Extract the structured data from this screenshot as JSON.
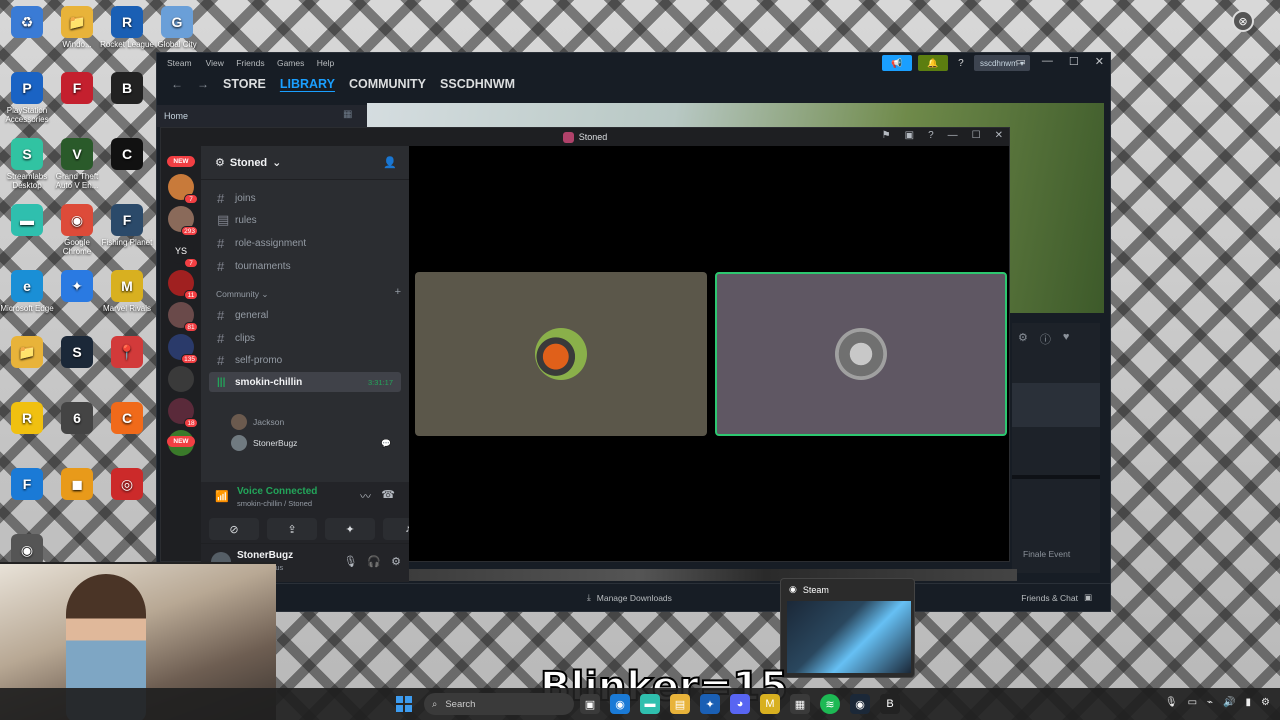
{
  "desktop": {
    "icons": [
      {
        "label": "",
        "glyph": "♻",
        "color": "#3a7bd5"
      },
      {
        "label": "Windo...",
        "glyph": "📁",
        "color": "#e8b33a"
      },
      {
        "label": "Rocket League",
        "glyph": "R",
        "color": "#1a5fb4"
      },
      {
        "label": "Global City",
        "glyph": "G",
        "color": "#6a9fd8"
      },
      {
        "label": "PlayStation Accessories",
        "glyph": "P",
        "color": "#1a63c4"
      },
      {
        "label": "",
        "glyph": "F",
        "color": "#c4202e"
      },
      {
        "label": "",
        "glyph": "B",
        "color": "#222222"
      },
      {
        "label": "Streamlabs Desktop",
        "glyph": "S",
        "color": "#31c3a2"
      },
      {
        "label": "Grand Theft Auto V En...",
        "glyph": "V",
        "color": "#2a5a2a"
      },
      {
        "label": "",
        "glyph": "C",
        "color": "#111111"
      },
      {
        "label": "",
        "glyph": "▬",
        "color": "#2fbfae"
      },
      {
        "label": "Google Chrome",
        "glyph": "◉",
        "color": "#dd4b39"
      },
      {
        "label": "Fishing Planet",
        "glyph": "F",
        "color": "#2b4a6a"
      },
      {
        "label": "Microsoft Edge",
        "glyph": "e",
        "color": "#1a8fd6"
      },
      {
        "label": "",
        "glyph": "✦",
        "color": "#2a7ae2"
      },
      {
        "label": "Marvel Rivals",
        "glyph": "M",
        "color": "#d8b020"
      },
      {
        "label": "",
        "glyph": "📁",
        "color": "#e8b33a"
      },
      {
        "label": "",
        "glyph": "S",
        "color": "#1b2838"
      },
      {
        "label": "",
        "glyph": "📍",
        "color": "#d23a3a"
      },
      {
        "label": "",
        "glyph": "R",
        "color": "#f0c010"
      },
      {
        "label": "",
        "glyph": "6",
        "color": "#444444"
      },
      {
        "label": "",
        "glyph": "C",
        "color": "#f06a1a"
      },
      {
        "label": "",
        "glyph": "F",
        "color": "#1a7ad6"
      },
      {
        "label": "",
        "glyph": "◼",
        "color": "#e89a1a"
      },
      {
        "label": "",
        "glyph": "◎",
        "color": "#cc2a2a"
      },
      {
        "label": "",
        "glyph": "◉",
        "color": "#555555"
      }
    ]
  },
  "steam": {
    "title": "Steam",
    "menu": [
      "View",
      "Friends",
      "Games",
      "Help"
    ],
    "nav": {
      "back": "←",
      "forward": "→",
      "store": "STORE",
      "library": "LIBRARY",
      "community": "COMMUNITY",
      "user": "SSCDHNWM"
    },
    "account": "sscdhnwm",
    "help_glyph": "?",
    "home": "Home",
    "finale": "Finale Event",
    "manage_downloads": "Manage Downloads",
    "friends_chat": "Friends & Chat",
    "window_controls": [
      "▭",
      "—",
      "☐",
      "✕"
    ]
  },
  "discord": {
    "window_title": "Stoned",
    "server_name": "Stoned",
    "window_controls": [
      "⚑",
      "▣",
      "?",
      "—",
      "☐",
      "✕"
    ],
    "guilds": [
      {
        "badge": "7",
        "color": "#c87a3a"
      },
      {
        "badge": "293",
        "color": "#8a6a5a"
      },
      {
        "badge": "7",
        "color": "#1e1f22",
        "text": "YS"
      },
      {
        "badge": "11",
        "color": "#a02020"
      },
      {
        "badge": "81",
        "color": "#6a4a4a"
      },
      {
        "badge": "135",
        "color": "#2a3a6a"
      },
      {
        "badge": "",
        "color": "#3a3a3a"
      },
      {
        "badge": "18",
        "color": "#5a2a3a"
      },
      {
        "badge": "",
        "color": "#3a7a2a"
      }
    ],
    "new_label": "NEW",
    "channels": [
      {
        "name": "joins"
      },
      {
        "name": "rules"
      },
      {
        "name": "role-assignment"
      },
      {
        "name": "tournaments"
      }
    ],
    "category": "Community",
    "community_channels": [
      {
        "name": "general"
      },
      {
        "name": "clips"
      },
      {
        "name": "self-promo"
      }
    ],
    "voice_channel": {
      "name": "smokin-chillin",
      "time": "3:31:17"
    },
    "voice_users": [
      {
        "name": "Jackson"
      },
      {
        "name": "StonerBugz"
      }
    ],
    "voice_panel": {
      "status": "Voice Connected",
      "sub": "smokin-chillin / Stoned"
    },
    "user": {
      "name": "StonerBugz",
      "status": "my first status"
    }
  },
  "preview": {
    "title": "Steam"
  },
  "overlay_text": "Blinker=15",
  "taskbar": {
    "search": "Search"
  },
  "colors": {
    "discord_green": "#23a55a",
    "steam_blue": "#1a9fff",
    "tile_left": "#5b574a",
    "tile_right": "#5f5763",
    "speaking_border": "#2dc770"
  }
}
